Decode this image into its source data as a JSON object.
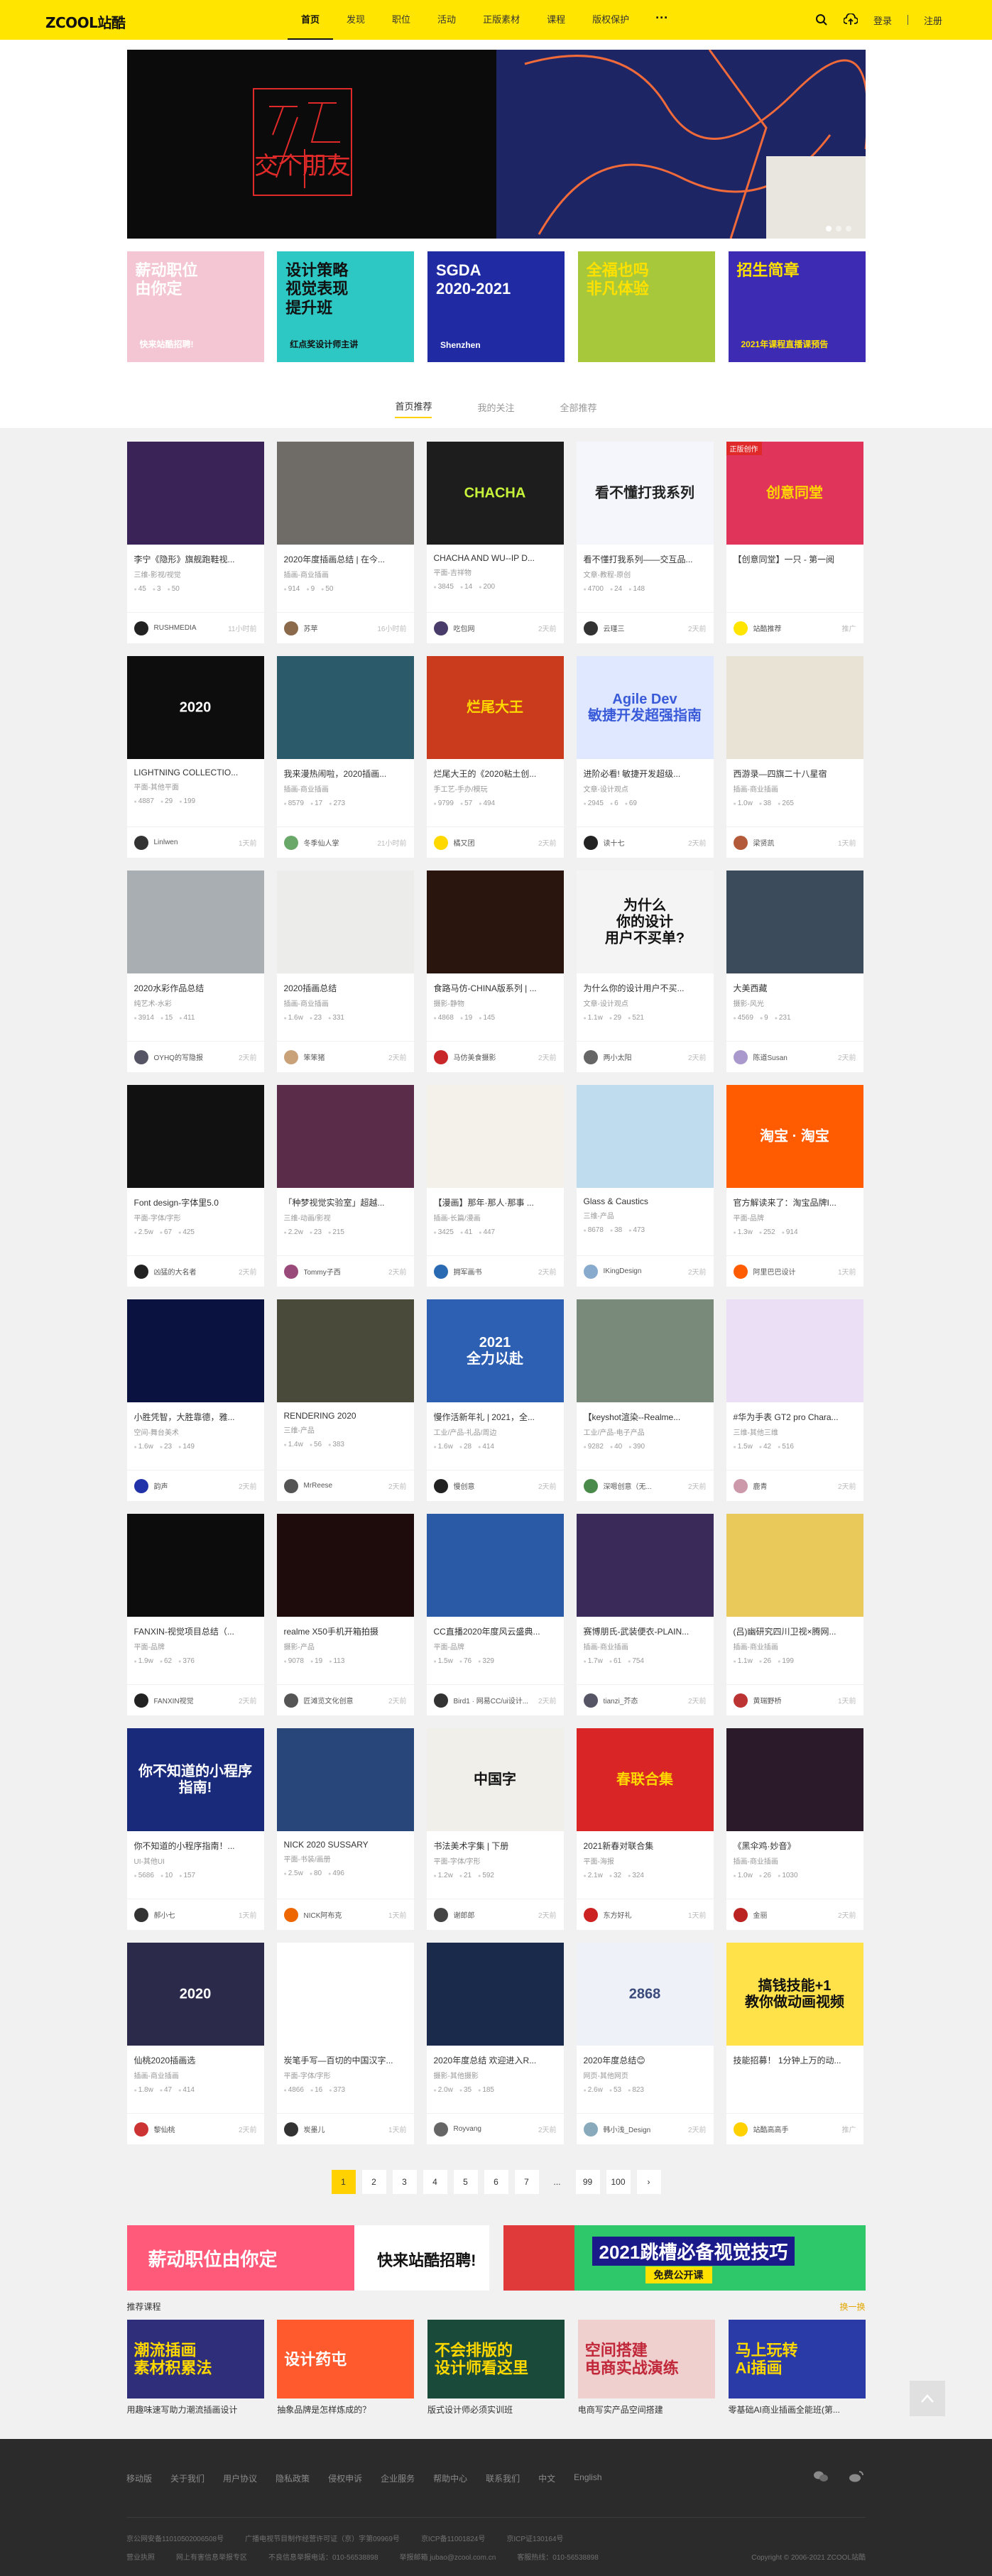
{
  "header": {
    "logo": "ZCOOL站酷",
    "nav": [
      "首页",
      "发现",
      "职位",
      "活动",
      "正版素材",
      "课程",
      "版权保护"
    ],
    "more": "···",
    "login": "登录",
    "register": "注册"
  },
  "hero": {
    "left_art": "交个朋友"
  },
  "promos": [
    {
      "t1": "薪动职位\n由你定",
      "t2": "快来站酷招聘!",
      "bg": "#f4c6d3",
      "fg": "#ffffff"
    },
    {
      "t1": "设计策略\n视觉表现\n提升班",
      "t2": "红点奖设计师主讲",
      "bg": "#2ec8c4",
      "fg": "#111111"
    },
    {
      "t1": "SGDA\n2020-2021",
      "t2": "Shenzhen",
      "bg": "#1f2aa3",
      "fg": "#ffffff"
    },
    {
      "t1": "全福也吗\n非凡体验",
      "t2": "",
      "bg": "#a7c83a",
      "fg": "#ffe100"
    },
    {
      "t1": "招生简章",
      "t2": "2021年课程直播课预告",
      "bg": "#3d2bb4",
      "fg": "#ffe100"
    }
  ],
  "tabs": [
    "首页推荐",
    "我的关注",
    "全部推荐"
  ],
  "cards": [
    {
      "title": "李宁《隐形》旗舰跑鞋视...",
      "cat": "三维-影视/视觉",
      "v": "45",
      "c": "3",
      "l": "50",
      "author": "RUSHMEDIA",
      "time": "11小时前",
      "bg": "#3a2357",
      "ov": "",
      "fg": "#fff",
      "av": "#222"
    },
    {
      "title": "2020年度插画总结 | 在今...",
      "cat": "插画-商业插画",
      "v": "914",
      "c": "9",
      "l": "50",
      "author": "苏苹",
      "time": "16小时前",
      "bg": "#6f6b66",
      "ov": "",
      "fg": "#fff",
      "av": "#8a6a4a"
    },
    {
      "title": "CHACHA AND WU--IP D...",
      "cat": "平面-吉祥物",
      "v": "3845",
      "c": "14",
      "l": "200",
      "author": "吃包网",
      "time": "2天前",
      "bg": "#1d1d1d",
      "ov": "CHACHA",
      "fg": "#c7f23a",
      "av": "#4a3c6a"
    },
    {
      "title": "看不懂打我系列——交互品...",
      "cat": "文章-教程-原创",
      "v": "4700",
      "c": "24",
      "l": "148",
      "author": "云瑾三",
      "time": "2天前",
      "bg": "#f4f6fb",
      "ov": "看不懂打我系列",
      "fg": "#222",
      "av": "#333"
    },
    {
      "title": "【创意同堂】一只 - 第一阅",
      "cat": "",
      "v": "",
      "c": "",
      "l": "",
      "author": "站酷推荐",
      "time": "推广",
      "bg": "#e0345a",
      "ov": "创意同堂",
      "fg": "#ffd800",
      "av": "#ffe500",
      "badge": "正版创作"
    },
    {
      "title": "LIGHTNING COLLECTIO...",
      "cat": "平面-其他平面",
      "v": "4887",
      "c": "29",
      "l": "199",
      "author": "Linlwen",
      "time": "1天前",
      "bg": "#0d0d0d",
      "ov": "2020",
      "fg": "#fff",
      "av": "#333"
    },
    {
      "title": "我来漫热闹啦，2020插画...",
      "cat": "插画-商业插画",
      "v": "8579",
      "c": "17",
      "l": "273",
      "author": "冬季仙人掌",
      "time": "21小时前",
      "bg": "#2b5a6a",
      "ov": "",
      "fg": "#fff",
      "av": "#6aa86a"
    },
    {
      "title": "烂尾大王的《2020粘土创...",
      "cat": "手工艺-手办/模玩",
      "v": "9799",
      "c": "57",
      "l": "494",
      "author": "橘又团",
      "time": "2天前",
      "bg": "#c93b1c",
      "ov": "烂尾大王",
      "fg": "#ffd800",
      "av": "#ffd800"
    },
    {
      "title": "进阶必看! 敏捷开发超级...",
      "cat": "文章-设计观点",
      "v": "2945",
      "c": "6",
      "l": "69",
      "author": "读十七",
      "time": "2天前",
      "bg": "#dfe8ff",
      "ov": "Agile Dev\n敏捷开发超强指南",
      "fg": "#3a5bd9",
      "av": "#222"
    },
    {
      "title": "西游录—四旗二十八星宿",
      "cat": "插画-商业插画",
      "v": "1.0w",
      "c": "38",
      "l": "265",
      "author": "梁贤凯",
      "time": "1天前",
      "bg": "#e9e3d6",
      "ov": "",
      "fg": "#fff",
      "av": "#b25a3a"
    },
    {
      "title": "2020水彩作品总结",
      "cat": "纯艺术-水彩",
      "v": "3914",
      "c": "15",
      "l": "411",
      "author": "OYHQ的写隐报",
      "time": "2天前",
      "bg": "#a9aeb3",
      "ov": "",
      "fg": "#fff",
      "av": "#556"
    },
    {
      "title": "2020插画总结",
      "cat": "插画-商业插画",
      "v": "1.6w",
      "c": "23",
      "l": "331",
      "author": "笨笨猪",
      "time": "2天前",
      "bg": "#ececea",
      "ov": "",
      "fg": "#fff",
      "av": "#c9a27a"
    },
    {
      "title": "食路马仿-CHINA版系列 | ...",
      "cat": "摄影-静物",
      "v": "4868",
      "c": "19",
      "l": "145",
      "author": "马仿美食摄影",
      "time": "2天前",
      "bg": "#2a140e",
      "ov": "",
      "fg": "#fff",
      "av": "#c8282a"
    },
    {
      "title": "为什么你的设计用户不买...",
      "cat": "文章-设计观点",
      "v": "1.1w",
      "c": "29",
      "l": "521",
      "author": "两小太阳",
      "time": "2天前",
      "bg": "#f4f4f4",
      "ov": "为什么\n你的设计\n用户不买单?",
      "fg": "#111",
      "av": "#666"
    },
    {
      "title": "大美西藏",
      "cat": "摄影-风光",
      "v": "4569",
      "c": "9",
      "l": "231",
      "author": "陈道Susan",
      "time": "2天前",
      "bg": "#3b4b5b",
      "ov": "",
      "fg": "#fff",
      "av": "#a9c"
    },
    {
      "title": "Font design-字体里5.0",
      "cat": "平面-字体/字形",
      "v": "2.5w",
      "c": "67",
      "l": "425",
      "author": "凶猛的大名者",
      "time": "2天前",
      "bg": "#111111",
      "ov": "",
      "fg": "#fff",
      "av": "#222"
    },
    {
      "title": "「种梦视觉实验室」超越...",
      "cat": "三维-动画/影视",
      "v": "2.2w",
      "c": "23",
      "l": "215",
      "author": "Tommy子西",
      "time": "2天前",
      "bg": "#5a2c4a",
      "ov": "",
      "fg": "#fff",
      "av": "#9a4a7a"
    },
    {
      "title": "【漫画】那年·那人·那事 ...",
      "cat": "插画-长篇/漫画",
      "v": "3425",
      "c": "41",
      "l": "447",
      "author": "拥军画书",
      "time": "2天前",
      "bg": "#f4f1ea",
      "ov": "",
      "fg": "#fff",
      "av": "#2a6ab2"
    },
    {
      "title": "Glass & Caustics",
      "cat": "三维-产品",
      "v": "8678",
      "c": "38",
      "l": "473",
      "author": "IKingDesign",
      "time": "2天前",
      "bg": "#bfdcee",
      "ov": "",
      "fg": "#fff",
      "av": "#88aacc"
    },
    {
      "title": "官方解读来了：淘宝品牌I...",
      "cat": "平面-品牌",
      "v": "1.3w",
      "c": "252",
      "l": "914",
      "author": "阿里巴巴设计",
      "time": "1天前",
      "bg": "#ff5b00",
      "ov": "淘宝 · 淘宝",
      "fg": "#fff",
      "av": "#ff5b00"
    },
    {
      "title": "小胜凭智，大胜靠德，雅...",
      "cat": "空间-舞台美术",
      "v": "1.6w",
      "c": "23",
      "l": "149",
      "author": "韵声",
      "time": "2天前",
      "bg": "#0a1240",
      "ov": "",
      "fg": "#fff",
      "av": "#2233aa"
    },
    {
      "title": "RENDERING 2020",
      "cat": "三维-产品",
      "v": "1.4w",
      "c": "56",
      "l": "383",
      "author": "MrReese",
      "time": "2天前",
      "bg": "#4a4a3a",
      "ov": "",
      "fg": "#fff",
      "av": "#555"
    },
    {
      "title": "慢作活新年礼 | 2021，全...",
      "cat": "工业/产品-礼品/周边",
      "v": "1.6w",
      "c": "28",
      "l": "414",
      "author": "慢创意",
      "time": "2天前",
      "bg": "#2d5fb3",
      "ov": "2021\n全力以赴",
      "fg": "#fff",
      "av": "#222"
    },
    {
      "title": "【keyshot渲染--Realme...",
      "cat": "工业/产品-电子产品",
      "v": "9282",
      "c": "40",
      "l": "390",
      "author": "深嗯创意（无...",
      "time": "2天前",
      "bg": "#7a8a7a",
      "ov": "",
      "fg": "#fff",
      "av": "#4a8a4a"
    },
    {
      "title": "#华为手表 GT2 pro Chara...",
      "cat": "三维-其他三维",
      "v": "1.5w",
      "c": "42",
      "l": "516",
      "author": "鹿青",
      "time": "2天前",
      "bg": "#eadff5",
      "ov": "",
      "fg": "#fff",
      "av": "#c9a"
    },
    {
      "title": "FANXIN-视觉项目总结（...",
      "cat": "平面-品牌",
      "v": "1.9w",
      "c": "62",
      "l": "376",
      "author": "FANXIN视觉",
      "time": "2天前",
      "bg": "#0c0c0c",
      "ov": "",
      "fg": "#fff",
      "av": "#222"
    },
    {
      "title": "realme X50手机开箱拍摄",
      "cat": "摄影-产品",
      "v": "9078",
      "c": "19",
      "l": "113",
      "author": "匠滩览文化创意",
      "time": "2天前",
      "bg": "#1e0b0b",
      "ov": "",
      "fg": "#fff",
      "av": "#555"
    },
    {
      "title": "CC直播2020年度风云盛典...",
      "cat": "平面-品牌",
      "v": "1.5w",
      "c": "76",
      "l": "329",
      "author": "Bird1 · 网易CC/ui设计...",
      "time": "2天前",
      "bg": "#2a5aa6",
      "ov": "",
      "fg": "#fff",
      "av": "#333"
    },
    {
      "title": "赛博朋氏-武装便衣-PLAIN...",
      "cat": "插画-商业插画",
      "v": "1.7w",
      "c": "61",
      "l": "754",
      "author": "tianzi_芥态",
      "time": "2天前",
      "bg": "#3a2a5a",
      "ov": "",
      "fg": "#fff",
      "av": "#556"
    },
    {
      "title": "(吕)幽研究四川卫视×腾网...",
      "cat": "插画-商业插画",
      "v": "1.1w",
      "c": "26",
      "l": "199",
      "author": "黄瑞野桥",
      "time": "1天前",
      "bg": "#e8c95a",
      "ov": "",
      "fg": "#fff",
      "av": "#b33"
    },
    {
      "title": "你不知道的小程序指南！...",
      "cat": "UI-其他UI",
      "v": "5686",
      "c": "10",
      "l": "157",
      "author": "郝小七",
      "time": "1天前",
      "bg": "#1a2a7a",
      "ov": "你不知道的小程序指南!",
      "fg": "#fff",
      "av": "#333"
    },
    {
      "title": "NICK 2020 SUSSARY",
      "cat": "平面-书装/画册",
      "v": "2.5w",
      "c": "80",
      "l": "496",
      "author": "NICK阿布克",
      "time": "1天前",
      "bg": "#29467a",
      "ov": "",
      "fg": "#fff",
      "av": "#e60"
    },
    {
      "title": "书法美术字集 | 下册",
      "cat": "平面-字体/字形",
      "v": "1.2w",
      "c": "21",
      "l": "592",
      "author": "谢郎郎",
      "time": "2天前",
      "bg": "#f0efea",
      "ov": "中国字",
      "fg": "#111",
      "av": "#444"
    },
    {
      "title": "2021新春对联合集",
      "cat": "平面-海报",
      "v": "2.1w",
      "c": "32",
      "l": "324",
      "author": "东方好礼",
      "time": "1天前",
      "bg": "#d92525",
      "ov": "春联合集",
      "fg": "#ffd800",
      "av": "#c22"
    },
    {
      "title": "《黑伞鸡·妙音》",
      "cat": "插画-商业插画",
      "v": "1.0w",
      "c": "26",
      "l": "1030",
      "author": "金丽",
      "time": "2天前",
      "bg": "#2a1a2a",
      "ov": "",
      "fg": "#fff",
      "av": "#b22"
    },
    {
      "title": "仙桃2020插画选",
      "cat": "插画-商业插画",
      "v": "1.8w",
      "c": "47",
      "l": "414",
      "author": "黎仙桃",
      "time": "2天前",
      "bg": "#2b2a4a",
      "ov": "2020",
      "fg": "#fff",
      "av": "#c33"
    },
    {
      "title": "炭笔手写—百切的中国汉字...",
      "cat": "平面-字体/字形",
      "v": "4866",
      "c": "16",
      "l": "373",
      "author": "炭墨儿",
      "time": "1天前",
      "bg": "#ffffff",
      "ov": "",
      "fg": "#111",
      "av": "#333"
    },
    {
      "title": "2020年度总结 欢迎进入R...",
      "cat": "摄影-其他摄影",
      "v": "2.0w",
      "c": "35",
      "l": "185",
      "author": "Royvang",
      "time": "2天前",
      "bg": "#1a2a4a",
      "ov": "",
      "fg": "#fff",
      "av": "#666"
    },
    {
      "title": "2020年度总结😊",
      "cat": "网页-其他网页",
      "v": "2.6w",
      "c": "53",
      "l": "823",
      "author": "韩小浅_Design",
      "time": "2天前",
      "bg": "#eef2f8",
      "ov": "2868",
      "fg": "#3a4a7a",
      "av": "#8ab"
    },
    {
      "title": "技能招募！ 1分钟上万的动...",
      "cat": "",
      "v": "",
      "c": "",
      "l": "",
      "author": "站酷高高手",
      "time": "推广",
      "bg": "#ffe14a",
      "ov": "搞钱技能+1\n教你做动画视频",
      "fg": "#111",
      "av": "#ffd100"
    }
  ],
  "pager": [
    "1",
    "2",
    "3",
    "4",
    "5",
    "6",
    "7",
    "...",
    "99",
    "100",
    "›"
  ],
  "banners": [
    {
      "left": "薪动职位由你定",
      "right": "快来站酷招聘!"
    },
    {
      "left": "2021跳槽必备视觉技巧",
      "right": "免费公开课"
    }
  ],
  "courses_head": {
    "left": "推荐课程",
    "right": "换一换"
  },
  "courses": [
    {
      "title": "用趣味速写助力潮流插画设计",
      "ov": "潮流插画\n素材积累法",
      "bg": "#2e2e7a",
      "fg": "#ffd800"
    },
    {
      "title": "抽象品牌是怎样炼成的？",
      "ov": "设计药屯",
      "bg": "#ff5a2e",
      "fg": "#fff"
    },
    {
      "title": "版式设计师必须实训班",
      "ov": "不会排版的\n设计师看这里",
      "bg": "#1a4a3a",
      "fg": "#ffd800"
    },
    {
      "title": "电商写实产品空间搭建",
      "ov": "空间搭建\n电商实战演练",
      "bg": "#f0cfcf",
      "fg": "#c0283a"
    },
    {
      "title": "零基础AI商业插画全能班(第...",
      "ov": "马上玩转\nAi插画",
      "bg": "#2a3aa6",
      "fg": "#ffd800"
    }
  ],
  "footer": {
    "links": [
      "移动版",
      "关于我们",
      "用户协议",
      "隐私政策",
      "侵权申诉",
      "企业服务",
      "帮助中心",
      "联系我们",
      "中文",
      "English"
    ],
    "social": [
      "微信",
      "微博"
    ],
    "row1": [
      "京公网安备11010502006508号",
      "广播电视节目制作经营许可证（京）字第09969号",
      "京ICP备11001824号",
      "京ICP证130164号"
    ],
    "row2": [
      "营业执照",
      "网上有害信息举报专区",
      "不良信息举报电话：010-56538898",
      "举报邮箱 jubao@zcool.com.cn",
      "客服热线：010-56538898",
      "Copyright © 2006-2021 ZCOOL站酷"
    ]
  }
}
